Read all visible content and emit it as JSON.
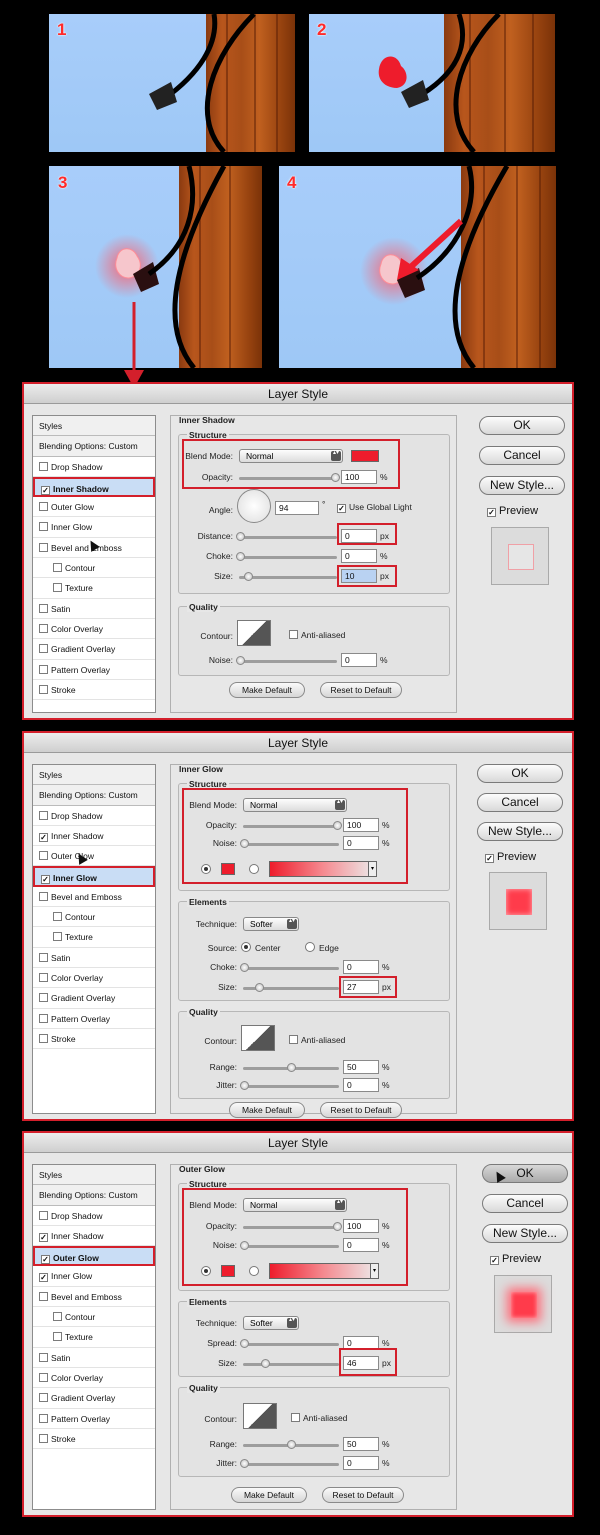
{
  "steps": [
    "1",
    "2",
    "3",
    "4"
  ],
  "colors": {
    "accent": "#d31f2b",
    "glow": "#ee1c2c",
    "sky": "#a9cffb"
  },
  "dialogs": [
    {
      "title": "Layer Style",
      "section": "Inner Shadow",
      "structure": "Structure",
      "blend_label": "Blend Mode:",
      "blend_value": "Normal",
      "opacity_label": "Opacity:",
      "opacity_value": "100",
      "pct": "%",
      "angle_label": "Angle:",
      "angle_value": "94",
      "deg": "°",
      "global_light": "Use Global Light",
      "distance_label": "Distance:",
      "distance_value": "0",
      "px": "px",
      "choke_label": "Choke:",
      "choke_value": "0",
      "size_label": "Size:",
      "size_value": "10",
      "quality": "Quality",
      "contour_label": "Contour:",
      "anti_aliased": "Anti-aliased",
      "noise_label": "Noise:",
      "noise_value": "0",
      "make_default": "Make Default",
      "reset_default": "Reset to Default",
      "selected_style": "Inner Shadow",
      "checked": [
        "Inner Shadow"
      ]
    },
    {
      "title": "Layer Style",
      "section": "Inner Glow",
      "structure": "Structure",
      "blend_label": "Blend Mode:",
      "blend_value": "Normal",
      "opacity_label": "Opacity:",
      "opacity_value": "100",
      "pct": "%",
      "noise_label": "Noise:",
      "noise_value": "0",
      "elements": "Elements",
      "technique_label": "Technique:",
      "technique_value": "Softer",
      "source_label": "Source:",
      "source_center": "Center",
      "source_edge": "Edge",
      "choke_label": "Choke:",
      "choke_value": "0",
      "size_label": "Size:",
      "size_value": "27",
      "px": "px",
      "quality": "Quality",
      "contour_label": "Contour:",
      "anti_aliased": "Anti-aliased",
      "range_label": "Range:",
      "range_value": "50",
      "jitter_label": "Jitter:",
      "jitter_value": "0",
      "make_default": "Make Default",
      "reset_default": "Reset to Default",
      "selected_style": "Inner Glow",
      "checked": [
        "Inner Shadow",
        "Inner Glow"
      ]
    },
    {
      "title": "Layer Style",
      "section": "Outer Glow",
      "structure": "Structure",
      "blend_label": "Blend Mode:",
      "blend_value": "Normal",
      "opacity_label": "Opacity:",
      "opacity_value": "100",
      "pct": "%",
      "noise_label": "Noise:",
      "noise_value": "0",
      "elements": "Elements",
      "technique_label": "Technique:",
      "technique_value": "Softer",
      "spread_label": "Spread:",
      "spread_value": "0",
      "size_label": "Size:",
      "size_value": "46",
      "px": "px",
      "quality": "Quality",
      "contour_label": "Contour:",
      "anti_aliased": "Anti-aliased",
      "range_label": "Range:",
      "range_value": "50",
      "jitter_label": "Jitter:",
      "jitter_value": "0",
      "make_default": "Make Default",
      "reset_default": "Reset to Default",
      "selected_style": "Outer Glow",
      "checked": [
        "Inner Shadow",
        "Outer Glow",
        "Inner Glow"
      ]
    }
  ],
  "styles_list": {
    "header": "Styles",
    "blending": "Blending Options: Custom",
    "items": [
      "Drop Shadow",
      "Inner Shadow",
      "Outer Glow",
      "Inner Glow",
      "Bevel and Emboss",
      "Contour",
      "Texture",
      "Satin",
      "Color Overlay",
      "Gradient Overlay",
      "Pattern Overlay",
      "Stroke"
    ]
  },
  "right_buttons": {
    "ok": "OK",
    "cancel": "Cancel",
    "new_style": "New Style...",
    "preview": "Preview"
  }
}
